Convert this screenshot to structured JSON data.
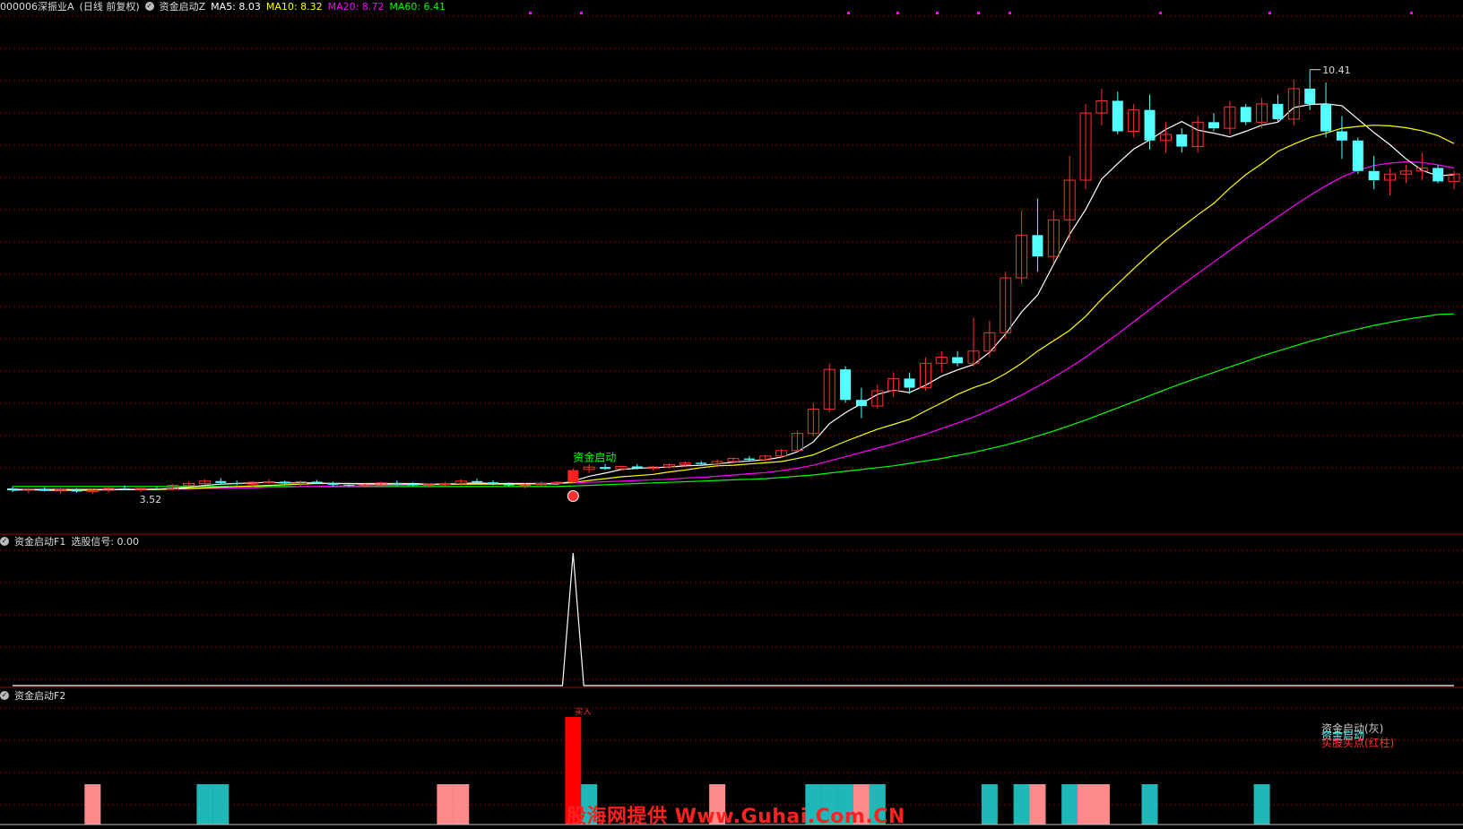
{
  "main_header": {
    "code": "000006",
    "name": "深振业A",
    "period": "(日线 前复权)",
    "indicator": "资金启动Z",
    "ma5": "MA5: 8.03",
    "ma10": "MA10: 8.32",
    "ma20": "MA20: 8.72",
    "ma60": "MA60: 6.41"
  },
  "panel_f1": {
    "title": "资金启动F1",
    "signal": "选股信号: 0.00"
  },
  "panel_f2": {
    "title": "资金启动F2"
  },
  "legend_f2": [
    "资金启动(灰)",
    "资金启动",
    "买股买点(红柱)"
  ],
  "bar_label": "买入",
  "signal_label": "资金启动",
  "watermark": "股海网提供 Www.Guhai.Com.CN",
  "colors": {
    "up": "#ff3030",
    "down": "#54ffff",
    "ma5": "#ffffff",
    "ma10": "#ffff00",
    "ma20": "#ff00ff",
    "ma60": "#00ff00",
    "bg": "#000000",
    "grid": "#8b0000"
  },
  "chart_data": {
    "type": "candlestick",
    "price_high_label": "10.41",
    "price_low_label": "3.52",
    "ohlc": [
      [
        3.55,
        3.58,
        3.49,
        3.52
      ],
      [
        3.52,
        3.56,
        3.47,
        3.54
      ],
      [
        3.54,
        3.57,
        3.5,
        3.51
      ],
      [
        3.51,
        3.56,
        3.46,
        3.53
      ],
      [
        3.53,
        3.55,
        3.48,
        3.5
      ],
      [
        3.5,
        3.54,
        3.46,
        3.52
      ],
      [
        3.52,
        3.58,
        3.48,
        3.55
      ],
      [
        3.55,
        3.6,
        3.52,
        3.53
      ],
      [
        3.53,
        3.56,
        3.49,
        3.55
      ],
      [
        3.55,
        3.58,
        3.52,
        3.54
      ],
      [
        3.54,
        3.62,
        3.52,
        3.6
      ],
      [
        3.6,
        3.66,
        3.58,
        3.63
      ],
      [
        3.63,
        3.7,
        3.6,
        3.67
      ],
      [
        3.67,
        3.72,
        3.62,
        3.64
      ],
      [
        3.64,
        3.68,
        3.6,
        3.62
      ],
      [
        3.62,
        3.67,
        3.58,
        3.65
      ],
      [
        3.65,
        3.7,
        3.62,
        3.66
      ],
      [
        3.66,
        3.68,
        3.6,
        3.63
      ],
      [
        3.63,
        3.68,
        3.59,
        3.66
      ],
      [
        3.66,
        3.69,
        3.62,
        3.64
      ],
      [
        3.64,
        3.66,
        3.58,
        3.61
      ],
      [
        3.61,
        3.64,
        3.57,
        3.6
      ],
      [
        3.6,
        3.63,
        3.56,
        3.61
      ],
      [
        3.61,
        3.66,
        3.58,
        3.64
      ],
      [
        3.64,
        3.68,
        3.6,
        3.62
      ],
      [
        3.62,
        3.65,
        3.58,
        3.6
      ],
      [
        3.6,
        3.63,
        3.56,
        3.62
      ],
      [
        3.62,
        3.66,
        3.59,
        3.63
      ],
      [
        3.63,
        3.7,
        3.6,
        3.67
      ],
      [
        3.67,
        3.71,
        3.63,
        3.65
      ],
      [
        3.65,
        3.68,
        3.6,
        3.62
      ],
      [
        3.62,
        3.65,
        3.58,
        3.6
      ],
      [
        3.6,
        3.64,
        3.55,
        3.61
      ],
      [
        3.61,
        3.66,
        3.58,
        3.63
      ],
      [
        3.63,
        3.67,
        3.6,
        3.65
      ],
      [
        3.65,
        3.88,
        3.63,
        3.85
      ],
      [
        3.86,
        3.95,
        3.8,
        3.9
      ],
      [
        3.9,
        3.95,
        3.85,
        3.87
      ],
      [
        3.87,
        3.92,
        3.84,
        3.91
      ],
      [
        3.91,
        3.95,
        3.86,
        3.88
      ],
      [
        3.88,
        3.92,
        3.84,
        3.9
      ],
      [
        3.9,
        3.96,
        3.87,
        3.94
      ],
      [
        3.94,
        3.99,
        3.9,
        3.97
      ],
      [
        3.97,
        4.0,
        3.93,
        3.95
      ],
      [
        3.95,
        4.02,
        3.92,
        3.99
      ],
      [
        3.99,
        4.06,
        3.96,
        4.04
      ],
      [
        4.04,
        4.08,
        4.0,
        4.02
      ],
      [
        4.02,
        4.1,
        3.99,
        4.08
      ],
      [
        4.08,
        4.2,
        4.05,
        4.17
      ],
      [
        4.17,
        4.5,
        4.15,
        4.45
      ],
      [
        4.45,
        4.95,
        4.4,
        4.85
      ],
      [
        4.85,
        5.6,
        4.8,
        5.5
      ],
      [
        5.5,
        5.55,
        4.95,
        5.0
      ],
      [
        5.0,
        5.2,
        4.7,
        4.9
      ],
      [
        4.9,
        5.25,
        4.85,
        5.15
      ],
      [
        5.15,
        5.45,
        5.05,
        5.35
      ],
      [
        5.35,
        5.45,
        5.1,
        5.2
      ],
      [
        5.2,
        5.7,
        5.15,
        5.6
      ],
      [
        5.6,
        5.8,
        5.45,
        5.7
      ],
      [
        5.7,
        5.8,
        5.55,
        5.6
      ],
      [
        5.6,
        6.35,
        5.55,
        5.8
      ],
      [
        5.8,
        6.3,
        5.7,
        6.1
      ],
      [
        6.1,
        7.1,
        6.0,
        7.0
      ],
      [
        7.0,
        8.1,
        6.9,
        7.7
      ],
      [
        7.7,
        8.3,
        7.1,
        7.35
      ],
      [
        7.35,
        8.1,
        7.25,
        7.95
      ],
      [
        7.95,
        9.0,
        7.6,
        8.6
      ],
      [
        8.6,
        9.85,
        8.45,
        9.7
      ],
      [
        9.7,
        10.1,
        9.5,
        9.9
      ],
      [
        9.9,
        10.05,
        9.35,
        9.4
      ],
      [
        9.4,
        9.85,
        9.3,
        9.75
      ],
      [
        9.75,
        10.0,
        9.1,
        9.25
      ],
      [
        9.25,
        9.55,
        9.05,
        9.35
      ],
      [
        9.35,
        9.45,
        9.05,
        9.15
      ],
      [
        9.15,
        9.65,
        9.05,
        9.55
      ],
      [
        9.55,
        9.7,
        9.4,
        9.45
      ],
      [
        9.45,
        9.9,
        9.35,
        9.8
      ],
      [
        9.8,
        9.85,
        9.5,
        9.55
      ],
      [
        9.55,
        9.95,
        9.45,
        9.85
      ],
      [
        9.85,
        10.0,
        9.55,
        9.6
      ],
      [
        9.6,
        10.25,
        9.5,
        10.1
      ],
      [
        10.1,
        10.41,
        9.75,
        9.85
      ],
      [
        9.85,
        10.2,
        9.3,
        9.4
      ],
      [
        9.4,
        9.65,
        8.95,
        9.25
      ],
      [
        9.25,
        9.3,
        8.7,
        8.75
      ],
      [
        8.75,
        9.0,
        8.45,
        8.6
      ],
      [
        8.6,
        8.8,
        8.35,
        8.7
      ],
      [
        8.7,
        8.85,
        8.55,
        8.75
      ],
      [
        8.75,
        9.05,
        8.6,
        8.8
      ],
      [
        8.8,
        8.85,
        8.55,
        8.58
      ],
      [
        8.58,
        8.75,
        8.45,
        8.7
      ]
    ],
    "ma5": [
      3.52,
      3.53,
      3.52,
      3.52,
      3.52,
      3.52,
      3.53,
      3.53,
      3.53,
      3.54,
      3.55,
      3.57,
      3.6,
      3.62,
      3.63,
      3.64,
      3.65,
      3.64,
      3.64,
      3.64,
      3.63,
      3.63,
      3.62,
      3.62,
      3.62,
      3.62,
      3.62,
      3.62,
      3.63,
      3.64,
      3.63,
      3.63,
      3.63,
      3.63,
      3.62,
      3.67,
      3.75,
      3.8,
      3.86,
      3.88,
      3.89,
      3.9,
      3.92,
      3.93,
      3.95,
      3.98,
      4.0,
      4.02,
      4.06,
      4.15,
      4.31,
      4.61,
      4.79,
      4.94,
      5.09,
      5.16,
      5.12,
      5.24,
      5.39,
      5.49,
      5.58,
      5.78,
      6.08,
      6.44,
      6.72,
      7.22,
      7.71,
      8.12,
      8.62,
      8.87,
      9.11,
      9.26,
      9.43,
      9.56,
      9.42,
      9.37,
      9.31,
      9.4,
      9.5,
      9.55,
      9.79,
      9.84,
      9.85,
      9.82,
      9.6,
      9.38,
      9.18,
      8.95,
      8.76,
      8.67,
      8.69
    ],
    "ma10": [
      3.53,
      3.53,
      3.53,
      3.53,
      3.53,
      3.53,
      3.53,
      3.53,
      3.53,
      3.53,
      3.54,
      3.55,
      3.56,
      3.57,
      3.58,
      3.59,
      3.6,
      3.61,
      3.62,
      3.63,
      3.63,
      3.63,
      3.63,
      3.63,
      3.63,
      3.63,
      3.62,
      3.62,
      3.62,
      3.62,
      3.62,
      3.62,
      3.62,
      3.63,
      3.63,
      3.65,
      3.68,
      3.71,
      3.74,
      3.76,
      3.78,
      3.82,
      3.85,
      3.89,
      3.92,
      3.93,
      3.95,
      3.97,
      3.99,
      4.04,
      4.1,
      4.21,
      4.32,
      4.42,
      4.52,
      4.6,
      4.68,
      4.82,
      4.95,
      5.09,
      5.2,
      5.29,
      5.43,
      5.6,
      5.8,
      5.97,
      6.14,
      6.37,
      6.65,
      6.9,
      7.15,
      7.39,
      7.62,
      7.83,
      8.03,
      8.22,
      8.47,
      8.69,
      8.87,
      9.07,
      9.19,
      9.3,
      9.37,
      9.45,
      9.48,
      9.5,
      9.49,
      9.46,
      9.41,
      9.33,
      9.2
    ],
    "ma20": [
      3.54,
      3.54,
      3.54,
      3.54,
      3.54,
      3.54,
      3.54,
      3.54,
      3.54,
      3.54,
      3.54,
      3.54,
      3.55,
      3.55,
      3.56,
      3.56,
      3.57,
      3.57,
      3.58,
      3.58,
      3.59,
      3.59,
      3.59,
      3.6,
      3.6,
      3.61,
      3.61,
      3.61,
      3.62,
      3.62,
      3.62,
      3.63,
      3.63,
      3.63,
      3.63,
      3.64,
      3.65,
      3.66,
      3.67,
      3.68,
      3.69,
      3.7,
      3.72,
      3.73,
      3.75,
      3.77,
      3.79,
      3.81,
      3.84,
      3.88,
      3.93,
      4.0,
      4.07,
      4.14,
      4.21,
      4.28,
      4.36,
      4.44,
      4.53,
      4.62,
      4.72,
      4.83,
      4.95,
      5.08,
      5.22,
      5.37,
      5.53,
      5.7,
      5.89,
      6.08,
      6.28,
      6.48,
      6.68,
      6.88,
      7.07,
      7.26,
      7.45,
      7.64,
      7.82,
      8.0,
      8.18,
      8.35,
      8.51,
      8.65,
      8.76,
      8.84,
      8.88,
      8.9,
      8.89,
      8.85,
      8.8
    ],
    "ma60": [
      3.58,
      3.58,
      3.58,
      3.58,
      3.58,
      3.58,
      3.58,
      3.58,
      3.58,
      3.58,
      3.58,
      3.58,
      3.58,
      3.58,
      3.58,
      3.58,
      3.58,
      3.58,
      3.58,
      3.58,
      3.58,
      3.58,
      3.58,
      3.58,
      3.58,
      3.58,
      3.58,
      3.58,
      3.58,
      3.58,
      3.58,
      3.58,
      3.58,
      3.58,
      3.58,
      3.59,
      3.6,
      3.61,
      3.62,
      3.63,
      3.64,
      3.65,
      3.66,
      3.67,
      3.68,
      3.69,
      3.7,
      3.71,
      3.73,
      3.75,
      3.77,
      3.8,
      3.83,
      3.86,
      3.89,
      3.92,
      3.96,
      4.0,
      4.04,
      4.09,
      4.14,
      4.2,
      4.26,
      4.33,
      4.41,
      4.49,
      4.58,
      4.67,
      4.77,
      4.87,
      4.97,
      5.07,
      5.17,
      5.27,
      5.36,
      5.45,
      5.54,
      5.63,
      5.72,
      5.8,
      5.88,
      5.96,
      6.03,
      6.1,
      6.16,
      6.22,
      6.27,
      6.32,
      6.36,
      6.4,
      6.41
    ],
    "signal_index": 35,
    "f1_signal": {
      "peak_index": 35,
      "peak_value": 1,
      "value": 0.0
    },
    "f2_bars": [
      {
        "i": 5,
        "c": "pink"
      },
      {
        "i": 12,
        "c": "cyan"
      },
      {
        "i": 13,
        "c": "cyan"
      },
      {
        "i": 27,
        "c": "pink"
      },
      {
        "i": 28,
        "c": "pink"
      },
      {
        "i": 35,
        "c": "red"
      },
      {
        "i": 36,
        "c": "cyan"
      },
      {
        "i": 44,
        "c": "pink"
      },
      {
        "i": 50,
        "c": "cyan"
      },
      {
        "i": 51,
        "c": "cyan"
      },
      {
        "i": 52,
        "c": "cyan"
      },
      {
        "i": 53,
        "c": "pink"
      },
      {
        "i": 54,
        "c": "cyan"
      },
      {
        "i": 61,
        "c": "cyan"
      },
      {
        "i": 63,
        "c": "cyan"
      },
      {
        "i": 64,
        "c": "pink"
      },
      {
        "i": 66,
        "c": "cyan"
      },
      {
        "i": 67,
        "c": "pink"
      },
      {
        "i": 68,
        "c": "pink"
      },
      {
        "i": 71,
        "c": "cyan"
      },
      {
        "i": 78,
        "c": "cyan"
      }
    ]
  }
}
